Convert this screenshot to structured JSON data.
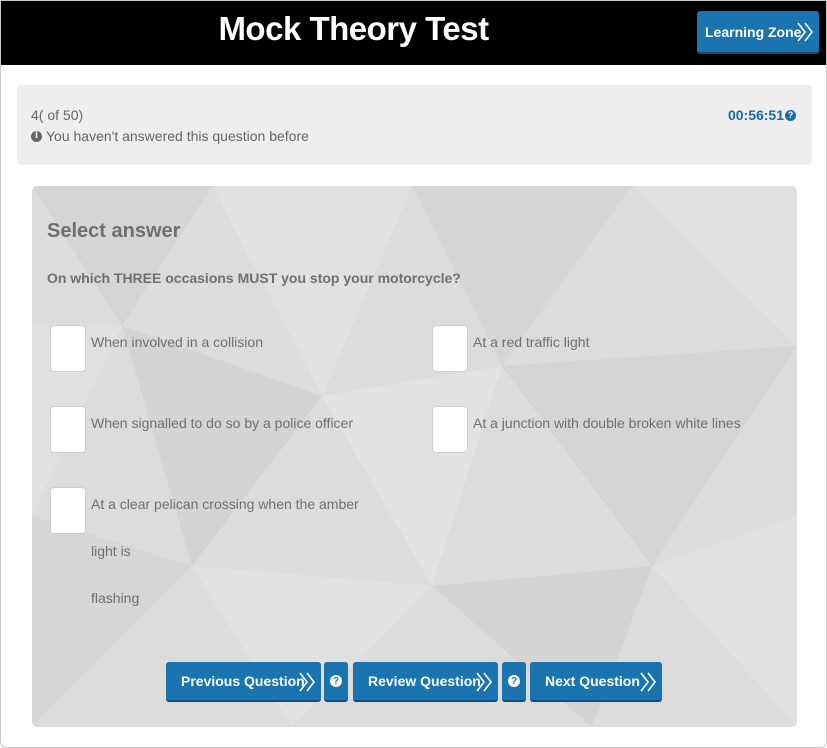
{
  "header": {
    "title": "Mock Theory Test",
    "learning_zone_label": "Learning Zone"
  },
  "status": {
    "question_count": "4( of 50)",
    "answer_note": "You haven't answered this question before",
    "timer": "00:56:51"
  },
  "question": {
    "heading": "Select answer",
    "text": "On which THREE occasions MUST you stop your motorcycle?",
    "options": [
      {
        "label": "When involved in a collision",
        "checked": false
      },
      {
        "label": "At a red traffic light",
        "checked": false
      },
      {
        "label": "When signalled to do so by a police officer",
        "checked": false
      },
      {
        "label": "At a junction with double broken white lines",
        "checked": false
      },
      {
        "label_line1": "At a clear pelican crossing when the amber light is",
        "label_line2": "flashing",
        "checked": false
      }
    ]
  },
  "nav": {
    "previous_label": "Previous Question",
    "review_label": "Review Question",
    "next_label": "Next Question"
  },
  "colors": {
    "header_bg": "#000000",
    "button_blue": "#1a74b0",
    "timer_blue": "#1a6aa0",
    "panel_bg": "#dcdcdc",
    "info_bar_bg": "#eeeeee"
  },
  "icons": {
    "chevron": "double-chevron-right-icon",
    "info": "info-icon",
    "help": "question-circle-icon"
  }
}
